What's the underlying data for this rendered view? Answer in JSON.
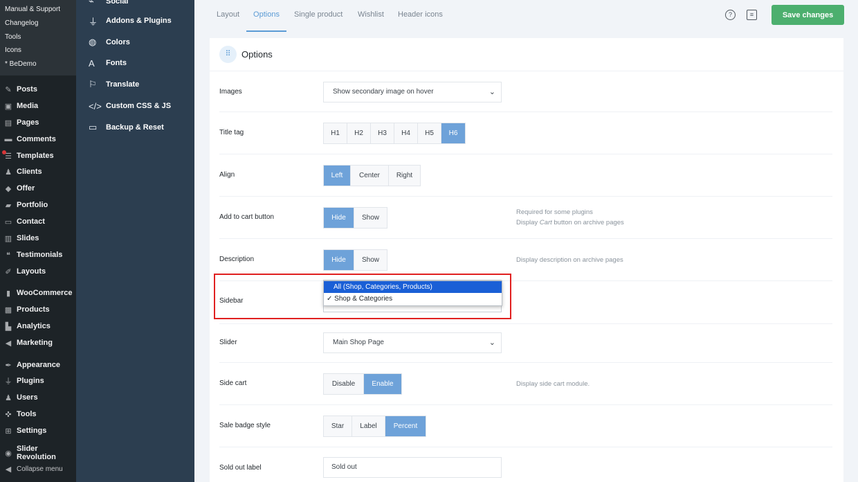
{
  "wp_sidebar": {
    "submenu": [
      "Manual & Support",
      "Changelog",
      "Tools",
      "Icons",
      "* BeDemo"
    ],
    "items": [
      {
        "label": "Posts",
        "icon": "pin-icon"
      },
      {
        "label": "Media",
        "icon": "media-icon"
      },
      {
        "label": "Pages",
        "icon": "pages-icon"
      },
      {
        "label": "Comments",
        "icon": "comment-icon"
      },
      {
        "label": "Templates",
        "icon": "templates-icon"
      },
      {
        "label": "Clients",
        "icon": "clients-icon"
      },
      {
        "label": "Offer",
        "icon": "offer-icon"
      },
      {
        "label": "Portfolio",
        "icon": "portfolio-icon"
      },
      {
        "label": "Contact",
        "icon": "contact-icon"
      },
      {
        "label": "Slides",
        "icon": "slides-icon"
      },
      {
        "label": "Testimonials",
        "icon": "quote-icon"
      },
      {
        "label": "Layouts",
        "icon": "layouts-icon"
      },
      {
        "label": "WooCommerce",
        "icon": "woo-icon"
      },
      {
        "label": "Products",
        "icon": "products-icon"
      },
      {
        "label": "Analytics",
        "icon": "analytics-icon"
      },
      {
        "label": "Marketing",
        "icon": "marketing-icon"
      },
      {
        "label": "Appearance",
        "icon": "appearance-icon"
      },
      {
        "label": "Plugins",
        "icon": "plugins-icon"
      },
      {
        "label": "Users",
        "icon": "users-icon"
      },
      {
        "label": "Tools",
        "icon": "tools-icon"
      },
      {
        "label": "Settings",
        "icon": "settings-icon"
      },
      {
        "label": "Slider Revolution",
        "icon": "slider-icon"
      },
      {
        "label": "Collapse menu",
        "icon": "collapse-icon"
      }
    ]
  },
  "be_sidebar": {
    "items": [
      {
        "label": "Social",
        "icon": "social-icon"
      },
      {
        "label": "Addons & Plugins",
        "icon": "plug-icon"
      },
      {
        "label": "Colors",
        "icon": "palette-icon"
      },
      {
        "label": "Fonts",
        "icon": "font-icon"
      },
      {
        "label": "Translate",
        "icon": "flag-icon"
      },
      {
        "label": "Custom CSS & JS",
        "icon": "code-icon"
      },
      {
        "label": "Backup & Reset",
        "icon": "backup-icon"
      }
    ]
  },
  "topbar": {
    "tabs": [
      "Layout",
      "Options",
      "Single product",
      "Wishlist",
      "Header icons"
    ],
    "active_tab": "Options",
    "save_label": "Save changes"
  },
  "panel": {
    "title": "Options",
    "rows": {
      "images": {
        "label": "Images",
        "value": "Show secondary image on hover"
      },
      "title_tag": {
        "label": "Title tag",
        "options": [
          "H1",
          "H2",
          "H3",
          "H4",
          "H5",
          "H6"
        ],
        "selected": "H6"
      },
      "align": {
        "label": "Align",
        "options": [
          "Left",
          "Center",
          "Right"
        ],
        "selected": "Left"
      },
      "add_to_cart": {
        "label": "Add to cart button",
        "options": [
          "Hide",
          "Show"
        ],
        "selected": "Hide",
        "help_line1": "Required for some plugins",
        "help_line2_pre": "Display ",
        "help_line2_em": "Cart",
        "help_line2_post": " button on archive pages"
      },
      "description": {
        "label": "Description",
        "options": [
          "Hide",
          "Show"
        ],
        "selected": "Hide",
        "help": "Display description on archive pages"
      },
      "sidebar": {
        "label": "Sidebar",
        "dropdown_options": [
          "All (Shop, Categories, Products)",
          "✓ Shop & Categories"
        ]
      },
      "slider": {
        "label": "Slider",
        "value": "Main Shop Page"
      },
      "side_cart": {
        "label": "Side cart",
        "options": [
          "Disable",
          "Enable"
        ],
        "selected": "Enable",
        "help": "Display side cart module."
      },
      "sale_badge": {
        "label": "Sale badge style",
        "options": [
          "Star",
          "Label",
          "Percent"
        ],
        "selected": "Percent"
      },
      "sold_out": {
        "label": "Sold out label",
        "value": "Sold out"
      }
    }
  },
  "colors": {
    "accent": "#6ea2d9",
    "save": "#4caf6e",
    "highlight": "#e02020"
  }
}
